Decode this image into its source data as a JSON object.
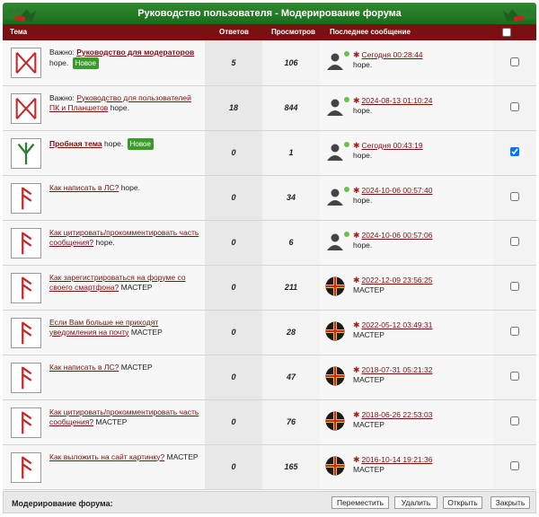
{
  "title": "Руководство пользователя - Модерирование форума",
  "columns": {
    "topic": "Тема",
    "replies": "Ответов",
    "views": "Просмотров",
    "last": "Последнее сообщение"
  },
  "rows": [
    {
      "prefix": "Важно:",
      "title": "Руководство для модераторов",
      "bold": true,
      "author": "hope.",
      "badge": "Новое",
      "replies": "5",
      "views": "106",
      "last_date": "Сегодня 00:28:44",
      "last_author": "hope.",
      "avatar": "user",
      "online": true,
      "icon": "rune-ingwaz",
      "checked": false
    },
    {
      "prefix": "Важно:",
      "title": "Руководство для пользователей ПК и Планшетов",
      "bold": false,
      "author": "hope.",
      "badge": "",
      "replies": "18",
      "views": "844",
      "last_date": "2024-08-13 01:10:24",
      "last_author": "hope.",
      "avatar": "user",
      "online": true,
      "icon": "rune-ingwaz",
      "checked": false
    },
    {
      "prefix": "",
      "title": "Пробная тема",
      "bold": true,
      "author": "hope.",
      "badge": "Новое",
      "replies": "0",
      "views": "1",
      "last_date": "Сегодня 00:43:19",
      "last_author": "hope.",
      "avatar": "user",
      "online": true,
      "icon": "rune-algiz",
      "checked": true
    },
    {
      "prefix": "",
      "title": "Как написать в ЛС?",
      "bold": false,
      "author": "hope.",
      "badge": "",
      "replies": "0",
      "views": "34",
      "last_date": "2024-10-06 00:57:40",
      "last_author": "hope.",
      "avatar": "user",
      "online": true,
      "icon": "rune-ansuz",
      "checked": false
    },
    {
      "prefix": "",
      "title": "Как цитировать/прокомментировать часть сообщения?",
      "bold": false,
      "author": "hope.",
      "badge": "",
      "replies": "0",
      "views": "6",
      "last_date": "2024-10-06 00:57:06",
      "last_author": "hope.",
      "avatar": "user",
      "online": true,
      "icon": "rune-ansuz",
      "checked": false
    },
    {
      "prefix": "",
      "title": "Как зарегистрироваться на форуме со своего смартфона?",
      "bold": false,
      "author": "МАСТЕР",
      "badge": "",
      "replies": "0",
      "views": "211",
      "last_date": "2022-12-09 23:56:25",
      "last_author": "МАСТЕР",
      "avatar": "cross",
      "online": false,
      "icon": "rune-ansuz",
      "checked": false
    },
    {
      "prefix": "",
      "title": "Если Вам больше не приходят уведомления на почту",
      "bold": false,
      "author": "МАСТЕР",
      "badge": "",
      "replies": "0",
      "views": "28",
      "last_date": "2022-05-12 03:49:31",
      "last_author": "МАСТЕР",
      "avatar": "cross",
      "online": false,
      "icon": "rune-ansuz",
      "checked": false
    },
    {
      "prefix": "",
      "title": "Как написать в ЛС?",
      "bold": false,
      "author": "МАСТЕР",
      "badge": "",
      "replies": "0",
      "views": "47",
      "last_date": "2018-07-31 05:21:32",
      "last_author": "МАСТЕР",
      "avatar": "cross",
      "online": false,
      "icon": "rune-ansuz",
      "checked": false
    },
    {
      "prefix": "",
      "title": "Как цитировать/прокомментировать часть сообщения?",
      "bold": false,
      "author": "МАСТЕР",
      "badge": "",
      "replies": "0",
      "views": "76",
      "last_date": "2018-06-26 22:53:03",
      "last_author": "МАСТЕР",
      "avatar": "cross",
      "online": false,
      "icon": "rune-ansuz",
      "checked": false
    },
    {
      "prefix": "",
      "title": "Как выложить на сайт картинку?",
      "bold": false,
      "author": "МАСТЕР",
      "badge": "",
      "replies": "0",
      "views": "165",
      "last_date": "2016-10-14 19:21:36",
      "last_author": "МАСТЕР",
      "avatar": "cross",
      "online": false,
      "icon": "rune-ansuz",
      "checked": false
    }
  ],
  "footer": {
    "label": "Модерирование форума:",
    "move": "Переместить",
    "delete": "Удалить",
    "open": "Открыть",
    "close": "Закрыть"
  },
  "colors": {
    "accent": "#7a1010",
    "title_bar": "#2e8b2e",
    "badge": "#3a9b2a",
    "online": "#6cc04a"
  }
}
